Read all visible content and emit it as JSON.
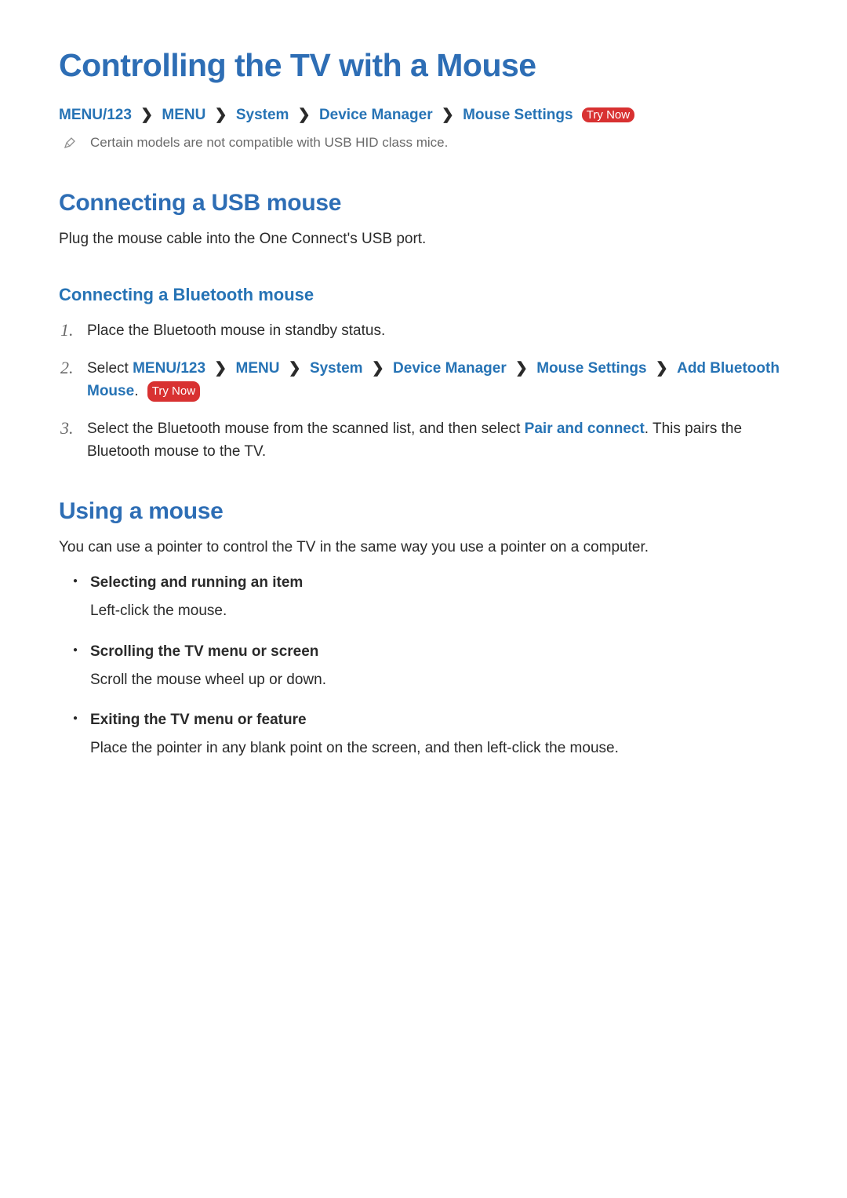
{
  "title": "Controlling the TV with a Mouse",
  "breadcrumb": {
    "items": [
      "MENU/123",
      "MENU",
      "System",
      "Device Manager",
      "Mouse Settings"
    ],
    "try_now_label": "Try Now"
  },
  "note": {
    "icon_name": "pencil-icon",
    "text": "Certain models are not compatible with USB HID class mice."
  },
  "sections": {
    "usb": {
      "title": "Connecting a USB mouse",
      "body": "Plug the mouse cable into the One Connect's USB port."
    },
    "bluetooth": {
      "title": "Connecting a Bluetooth mouse",
      "steps": {
        "s1": {
          "num": "1.",
          "text": "Place the Bluetooth mouse in standby status."
        },
        "s2": {
          "num": "2.",
          "lead": "Select ",
          "path": [
            "MENU/123",
            "MENU",
            "System",
            "Device Manager",
            "Mouse Settings",
            "Add Bluetooth Mouse"
          ],
          "period": ".",
          "try_now_label": "Try Now"
        },
        "s3": {
          "num": "3.",
          "pre": "Select the Bluetooth mouse from the scanned list, and then select ",
          "link": "Pair and connect",
          "post": ". This pairs the Bluetooth mouse to the TV."
        }
      }
    },
    "using": {
      "title": "Using a mouse",
      "intro": "You can use a pointer to control the TV in the same way you use a pointer on a computer.",
      "bullets": {
        "b1": {
          "title": "Selecting and running an item",
          "body": "Left-click the mouse."
        },
        "b2": {
          "title": "Scrolling the TV menu or screen",
          "body": "Scroll the mouse wheel up or down."
        },
        "b3": {
          "title": "Exiting the TV menu or feature",
          "body": "Place the pointer in any blank point on the screen, and then left-click the mouse."
        }
      }
    }
  }
}
